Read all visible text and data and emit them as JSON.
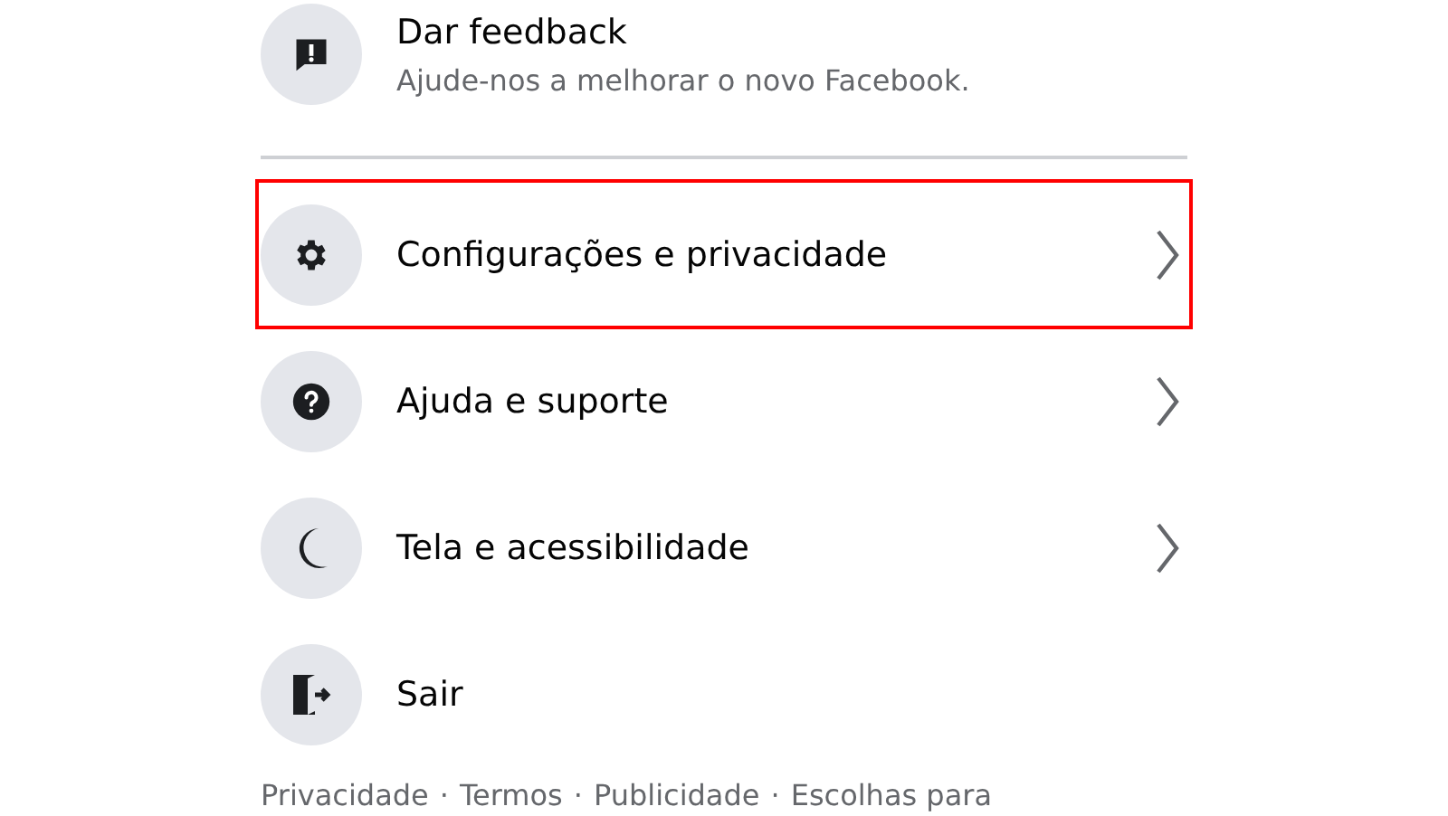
{
  "feedback": {
    "title": "Dar feedback",
    "subtitle": "Ajude-nos a melhorar o novo Facebook."
  },
  "menu": [
    {
      "label": "Configurações e privacidade",
      "has_arrow": true,
      "highlighted": true
    },
    {
      "label": "Ajuda e suporte",
      "has_arrow": true,
      "highlighted": false
    },
    {
      "label": "Tela e acessibilidade",
      "has_arrow": true,
      "highlighted": false
    },
    {
      "label": "Sair",
      "has_arrow": false,
      "highlighted": false
    }
  ],
  "footer": {
    "separator": "·",
    "links": [
      "Privacidade",
      "Termos",
      "Publicidade",
      "Escolhas para"
    ]
  }
}
